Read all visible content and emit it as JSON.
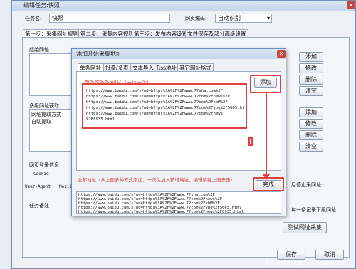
{
  "outer": {
    "title": "编辑任务:快照",
    "task_name_label": "任务名:",
    "task_name_value": "快照",
    "encoding_label": "网页编码:",
    "encoding_value": "自动识别"
  },
  "tabs": [
    "第一步：采集网址规则",
    "第二步：采集内容规则",
    "第三步：发布内容设置",
    "文件保存及部分高级设置"
  ],
  "left": {
    "start_url_label": "起始网址",
    "multi_fetch_label": "多级网址获取",
    "fetch_items": [
      "网址提取方式",
      "自动提取"
    ],
    "login_label": "网页登录信息",
    "cookie_label": "Cookie",
    "ua_label": "User-Agent",
    "ua_value": "Mozil",
    "notes_label": "任务备注"
  },
  "right_buttons": {
    "add1": "添加",
    "edit1": "修改",
    "del1": "删除",
    "clear1": "清空",
    "add2": "添加",
    "edit2": "修改",
    "del2": "删除",
    "clear2": "清空",
    "save": "保存",
    "cancel": "取消",
    "test": "测试网址采集",
    "stop_text": "后停止采网址:",
    "record_text": "每一条记录下级网址"
  },
  "dialog": {
    "title": "添加开始采集地址",
    "tabs": [
      "单条网址",
      "批量/多页",
      "文本导入",
      "Rss地址",
      "其它网址格式"
    ],
    "hint": "单条或多条网址：(一行一个)",
    "add_btn": "添加",
    "urls": [
      "https://www.baidu.com/s?wd=https%3A%2F%2Fwww.7?shw.com%2F",
      "https://www.baidu.com/s?wd=https%3A%2F%2Fwww.7?com%2Fnews%2F",
      "https://www.baidu.com/s?wd=https%3A%2F%2Fwww.7?com%2FxbM%2F",
      "https://www.baidu.com/s?wd=https%3A%2F%2Fwww.7?com%2Fybq%2F5665.html",
      "https://www.baidu.com/s?wd=https%3A%2F%2Fwww.7?com%2Fnews",
      "%2F8935.html"
    ],
    "all_label": "全部地址（从上面多种方式添加，一次性加入新增地址，编辑请在上面去击）",
    "done_btn": "完成",
    "list": [
      "https://www.baidu.com/s?wd=https%3A%2F%2Fwww.7?shw.com%2F",
      "https://www.baidu.com/s?wd=https%3A%2F%2Fwww.7?com%2Fnews%2F",
      "https://www.baidu.com/s?wd=https%3A%2F%2Fwww.7?com%2FxbM%2F",
      "https://www.baidu.com/s?wd=https%3A%2F%2Fwww.7?com%2Fybq%2F5665.html",
      "https://www.baidu.com/s?wd=https%3A%2F%2Fwww.7?com%2Fnews%2F8935.html"
    ]
  },
  "watermark": "Bai度经验 jingyan.baidu.com"
}
